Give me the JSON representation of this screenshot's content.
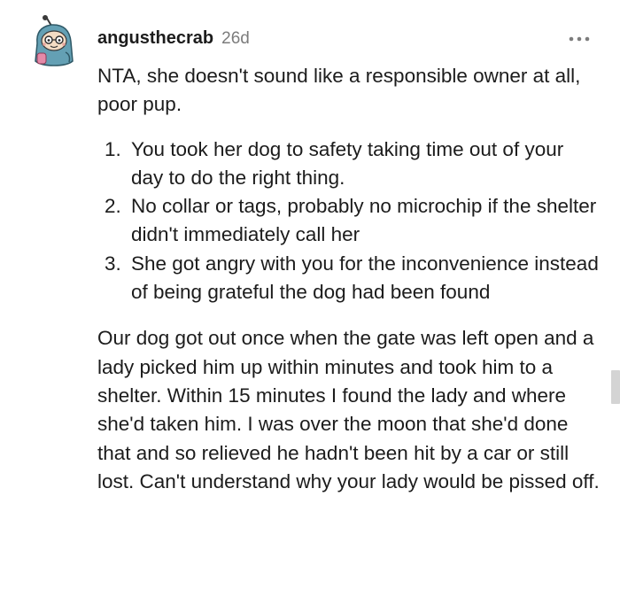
{
  "comment": {
    "username": "angusthecrab",
    "timestamp": "26d",
    "more_icon": "ellipsis-icon",
    "avatar_icon": "snoo-avatar-icon",
    "intro": "NTA, she doesn't sound like a responsible owner at all, poor pup.",
    "list": [
      {
        "number": "1.",
        "text": "You took her dog to safety taking time out of your day to do the right thing."
      },
      {
        "number": "2.",
        "text": "No collar or tags, probably no microchip if the shelter didn't immediately call her"
      },
      {
        "number": "3.",
        "text": "She got angry with you for the inconvenience instead of being grateful the dog had been found"
      }
    ],
    "story": "Our dog got out once when the gate was left open and a lady picked him up within minutes and took him to a shelter. Within 15 minutes I found the lady and where she'd taken him. I was over the moon that she'd done that and so relieved he hadn't been hit by a car or still lost. Can't understand why your lady would be pissed off."
  },
  "colors": {
    "text": "#1c1c1c",
    "meta": "#7c7c7c",
    "avatar_bg": "#d9e5ec",
    "avatar_suit": "#64a0b4"
  }
}
